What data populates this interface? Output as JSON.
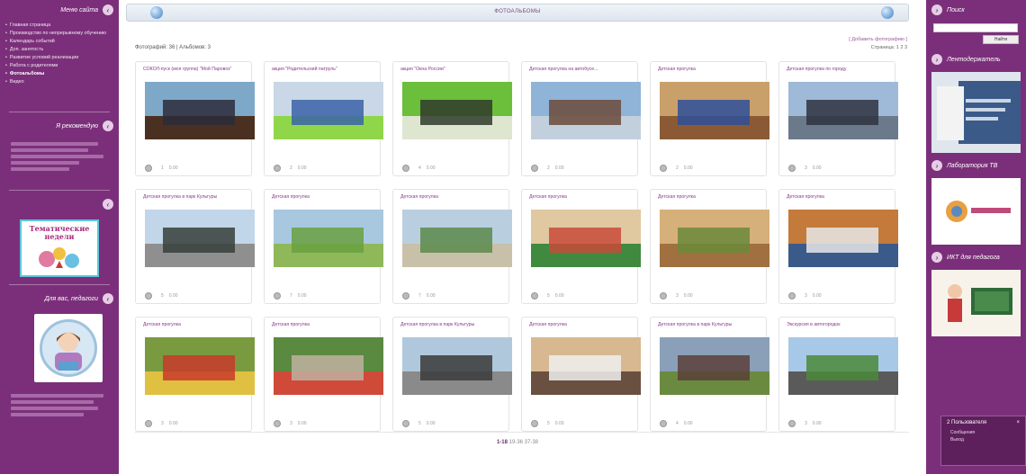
{
  "left_sidebar": {
    "menu_header": "Меню сайта",
    "menu_items": [
      "Главная страница",
      "Производство по непрерывному обучению",
      "Календарь событий",
      "Доп. занятость",
      "Развитие условий реализации",
      "Работа с родителями",
      "Фотоальбомы",
      "Видео"
    ],
    "active_index": 6,
    "section2_header": "Я рекомендую",
    "banner_title": "Тематические недели",
    "section4_header": "Для вас, педагоги"
  },
  "right_sidebar": {
    "search_header": "Поиск",
    "search_button": "Найти",
    "block2_header": "Лентодержатель",
    "block3_header": "Лаборатория ТВ",
    "block4_header": "ИКТ для педагога",
    "chat_title": "2 Пользователя",
    "chat_items": [
      "Сообщения",
      "Выход"
    ]
  },
  "main": {
    "title": "ФОТОАЛЬБОМЫ",
    "stats_text": "Фотографий: 36 | Альбомов: 3",
    "add_link": "[ Добавить фотографию ]",
    "pages_text": "Страница: 1 2 3",
    "pager": {
      "current": "1-18",
      "rest": "19-36 37-38"
    }
  },
  "cards": [
    {
      "title": "СОКОЛ-пуск (моя группа) \"Мой Паровоз\"",
      "views": "1",
      "rating": "0.00",
      "colors": [
        "#7ea8c8",
        "#2c2c3a",
        "#4a3020"
      ]
    },
    {
      "title": "акция \"Родительский патруль\"",
      "views": "2",
      "rating": "0.00",
      "colors": [
        "#c9d7e6",
        "#3b63a8",
        "#8fd64a"
      ]
    },
    {
      "title": "акция \"Окна России\"",
      "views": "4",
      "rating": "0.00",
      "colors": [
        "#6bbf3a",
        "#2f3a2a",
        "#dfe6d0"
      ]
    },
    {
      "title": "Детская прогулка на автобусе...",
      "views": "2",
      "rating": "0.00",
      "colors": [
        "#8fb4d8",
        "#6b4a3a",
        "#c2d0de"
      ]
    },
    {
      "title": "Детская прогулка",
      "views": "2",
      "rating": "0.00",
      "colors": [
        "#caa06a",
        "#2e4f9a",
        "#8b5a34"
      ]
    },
    {
      "title": "Детская прогулка по городу",
      "views": "3",
      "rating": "0.00",
      "colors": [
        "#9fb9d8",
        "#2e3340",
        "#6b7a8a"
      ]
    },
    {
      "title": "Детская прогулка в парк Культуры",
      "views": "5",
      "rating": "0.00",
      "colors": [
        "#c2d6ea",
        "#36403a",
        "#8f8f8f"
      ]
    },
    {
      "title": "Детская прогулка",
      "views": "7",
      "rating": "0.00",
      "colors": [
        "#a8c8e0",
        "#6aa040",
        "#8fb85a"
      ]
    },
    {
      "title": "Детская прогулка",
      "views": "7",
      "rating": "0.00",
      "colors": [
        "#b9cfe0",
        "#5a8a4a",
        "#c8c0a8"
      ]
    },
    {
      "title": "Детская прогулка",
      "views": "5",
      "rating": "0.00",
      "colors": [
        "#e0c8a0",
        "#c84a3a",
        "#3f8a3f"
      ]
    },
    {
      "title": "Детская прогулка",
      "views": "3",
      "rating": "0.00",
      "colors": [
        "#d6b07a",
        "#6a8a3a",
        "#a07040"
      ]
    },
    {
      "title": "Детская прогулка",
      "views": "3",
      "rating": "0.00",
      "colors": [
        "#c47a3a",
        "#e8e8e8",
        "#3a5a8a"
      ]
    },
    {
      "title": "Детская прогулка",
      "views": "3",
      "rating": "0.00",
      "colors": [
        "#7a9a40",
        "#c83a2a",
        "#e0c040"
      ]
    },
    {
      "title": "Детская прогулка",
      "views": "3",
      "rating": "0.00",
      "colors": [
        "#5a8a40",
        "#c0b0a0",
        "#d04a3a"
      ]
    },
    {
      "title": "Детская прогулка в парк Культуры",
      "views": "5",
      "rating": "0.00",
      "colors": [
        "#b0c8dc",
        "#3a3a3a",
        "#8a8a8a"
      ]
    },
    {
      "title": "Детская прогулка",
      "views": "5",
      "rating": "0.00",
      "colors": [
        "#d8b890",
        "#f0f0f0",
        "#6a5040"
      ]
    },
    {
      "title": "Детская прогулка в парк Культуры",
      "views": "4",
      "rating": "0.00",
      "colors": [
        "#8aa0b8",
        "#5a4038",
        "#6a8a40"
      ]
    },
    {
      "title": "Экскурсия в автогородок",
      "views": "3",
      "rating": "0.00",
      "colors": [
        "#a8c8e8",
        "#4a8a3a",
        "#5a5a5a"
      ]
    }
  ]
}
